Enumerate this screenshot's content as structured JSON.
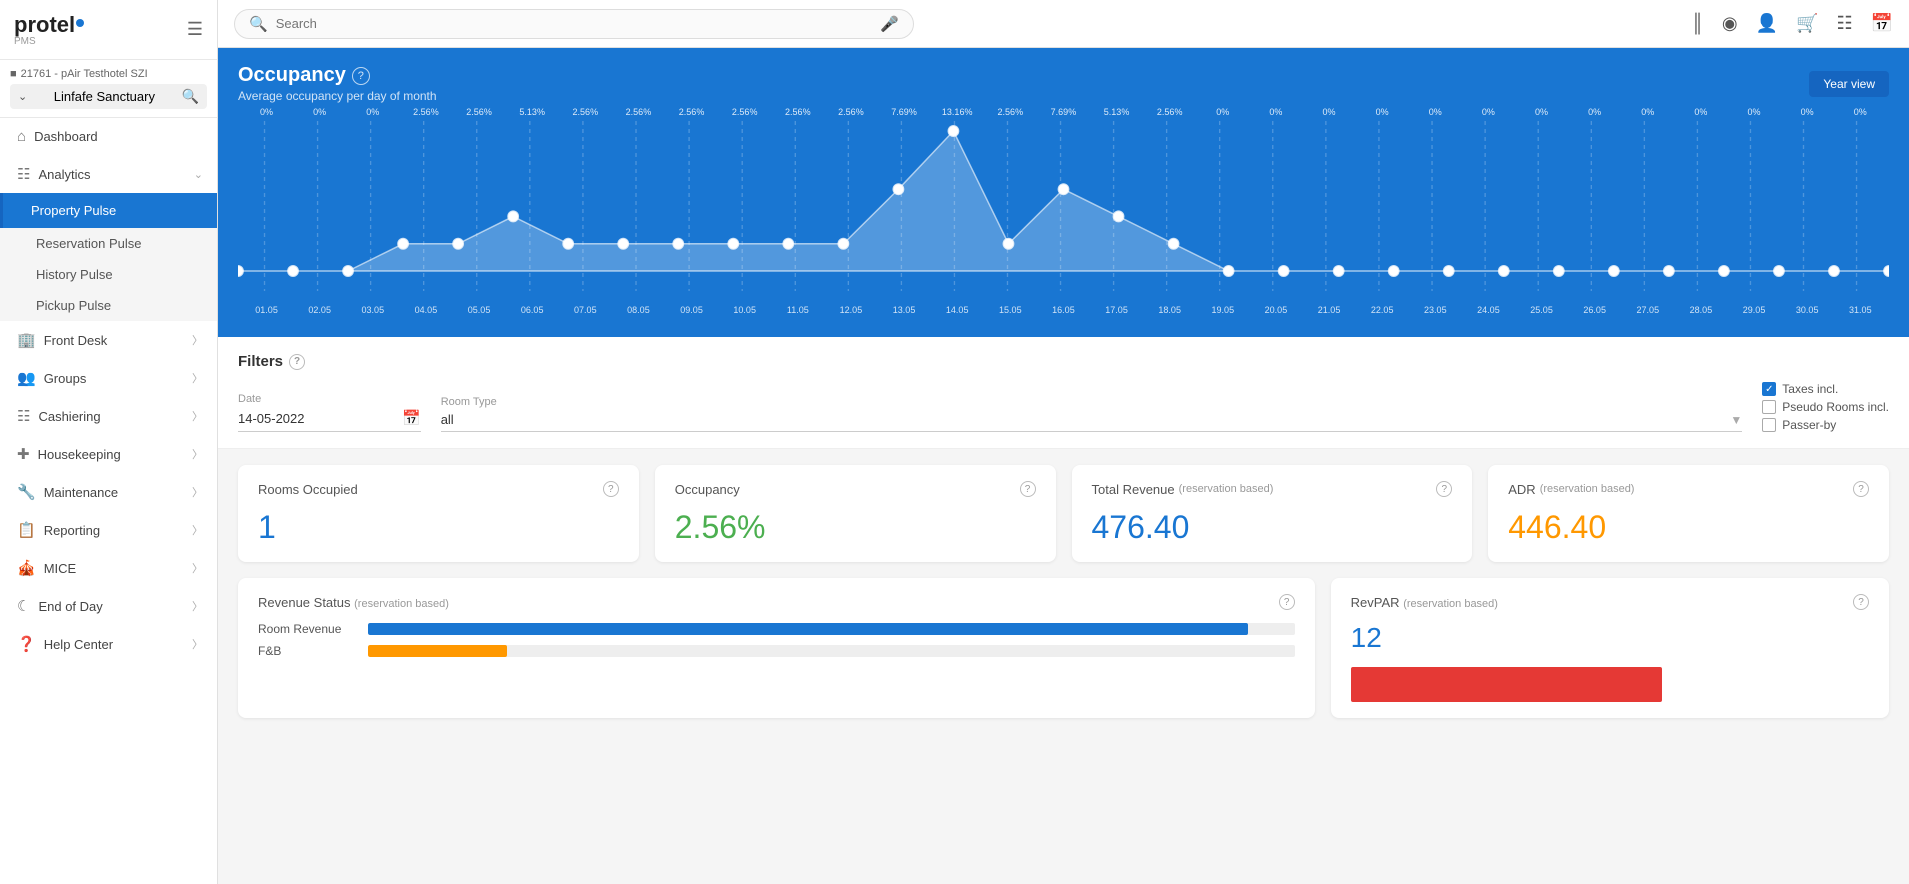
{
  "sidebar": {
    "logo": "protel",
    "logo_suffix": "●",
    "pms_label": "PMS",
    "hotel_id": "21761 - pAir Testhotel SZI",
    "hotel_name": "Linfafe Sanctuary",
    "nav_items": [
      {
        "id": "dashboard",
        "label": "Dashboard",
        "icon": "⌂",
        "has_arrow": false,
        "active": false
      },
      {
        "id": "analytics",
        "label": "Analytics",
        "icon": "📊",
        "has_arrow": true,
        "active": false,
        "expanded": true
      },
      {
        "id": "property-pulse",
        "label": "Property Pulse",
        "icon": "",
        "has_arrow": false,
        "active": true,
        "sub": true
      },
      {
        "id": "reservation-pulse",
        "label": "Reservation Pulse",
        "icon": "",
        "has_arrow": false,
        "active": false,
        "sub": true
      },
      {
        "id": "history-pulse",
        "label": "History Pulse",
        "icon": "",
        "has_arrow": false,
        "active": false,
        "sub": true
      },
      {
        "id": "pickup-pulse",
        "label": "Pickup Pulse",
        "icon": "",
        "has_arrow": false,
        "active": false,
        "sub": true
      },
      {
        "id": "front-desk",
        "label": "Front Desk",
        "icon": "🏨",
        "has_arrow": true,
        "active": false
      },
      {
        "id": "groups",
        "label": "Groups",
        "icon": "👥",
        "has_arrow": true,
        "active": false
      },
      {
        "id": "cashiering",
        "label": "Cashiering",
        "icon": "💳",
        "has_arrow": true,
        "active": false
      },
      {
        "id": "housekeeping",
        "label": "Housekeeping",
        "icon": "🧹",
        "has_arrow": true,
        "active": false
      },
      {
        "id": "maintenance",
        "label": "Maintenance",
        "icon": "🔧",
        "has_arrow": true,
        "active": false
      },
      {
        "id": "reporting",
        "label": "Reporting",
        "icon": "📋",
        "has_arrow": true,
        "active": false
      },
      {
        "id": "mice",
        "label": "MICE",
        "icon": "🎪",
        "has_arrow": true,
        "active": false
      },
      {
        "id": "end-of-day",
        "label": "End of Day",
        "icon": "🌙",
        "has_arrow": true,
        "active": false
      },
      {
        "id": "help-center",
        "label": "Help Center",
        "icon": "❓",
        "has_arrow": true,
        "active": false
      }
    ]
  },
  "topbar": {
    "search_placeholder": "Search",
    "icons": [
      "≡",
      "⊙",
      "👤",
      "🛒",
      "⋮⋮⋮",
      "📅"
    ]
  },
  "occupancy": {
    "title": "Occupancy",
    "subtitle": "Average occupancy per day of month",
    "year_view_btn": "Year view",
    "chart_labels": [
      "0%",
      "0%",
      "0%",
      "2.56%",
      "2.56%",
      "5.13%",
      "2.56%",
      "2.56%",
      "2.56%",
      "2.56%",
      "2.56%",
      "2.56%",
      "7.69%",
      "13.16%",
      "2.56%",
      "7.69%",
      "5.13%",
      "2.56%",
      "0%",
      "0%",
      "0%",
      "0%",
      "0%",
      "0%",
      "0%",
      "0%",
      "0%",
      "0%",
      "0%",
      "0%",
      "0%"
    ],
    "chart_dates": [
      "01.05",
      "02.05",
      "03.05",
      "04.05",
      "05.05",
      "06.05",
      "07.05",
      "08.05",
      "09.05",
      "10.05",
      "11.05",
      "12.05",
      "13.05",
      "14.05",
      "15.05",
      "16.05",
      "17.05",
      "18.05",
      "19.05",
      "20.05",
      "21.05",
      "22.05",
      "23.05",
      "24.05",
      "25.05",
      "26.05",
      "27.05",
      "28.05",
      "29.05",
      "30.05",
      "31.05"
    ]
  },
  "filters": {
    "title": "Filters",
    "date_label": "Date",
    "date_value": "14-05-2022",
    "room_type_label": "Room Type",
    "room_type_value": "all",
    "taxes_incl": {
      "label": "Taxes incl.",
      "checked": true
    },
    "pseudo_rooms": {
      "label": "Pseudo Rooms incl.",
      "checked": false
    },
    "passer_by": {
      "label": "Passer-by",
      "checked": false
    }
  },
  "stats": [
    {
      "id": "rooms-occupied",
      "title": "Rooms Occupied",
      "subtitle": "",
      "value": "1",
      "color": "blue"
    },
    {
      "id": "occupancy",
      "title": "Occupancy",
      "subtitle": "",
      "value": "2.56%",
      "color": "green"
    },
    {
      "id": "total-revenue",
      "title": "Total Revenue",
      "subtitle": "(reservation based)",
      "value": "476.40",
      "color": "blue"
    },
    {
      "id": "adr",
      "title": "ADR",
      "subtitle": "(reservation based)",
      "value": "446.40",
      "color": "orange"
    }
  ],
  "bottom_cards": [
    {
      "id": "revenue-status",
      "title": "Revenue Status",
      "subtitle": "(reservation based)",
      "bars": [
        {
          "label": "Room Revenue",
          "value": 95,
          "color": "#1976d2"
        },
        {
          "label": "F&B",
          "value": 15,
          "color": "#ff9800"
        }
      ]
    },
    {
      "id": "revpar",
      "title": "RevPAR",
      "subtitle": "(reservation based)",
      "value": "12"
    }
  ],
  "chart_data": {
    "points": [
      0,
      0,
      0,
      2.56,
      2.56,
      5.13,
      2.56,
      2.56,
      2.56,
      2.56,
      2.56,
      2.56,
      7.69,
      13.16,
      2.56,
      7.69,
      5.13,
      2.56,
      0,
      0,
      0,
      0,
      0,
      0,
      0,
      0,
      0,
      0,
      0,
      0,
      0
    ]
  }
}
